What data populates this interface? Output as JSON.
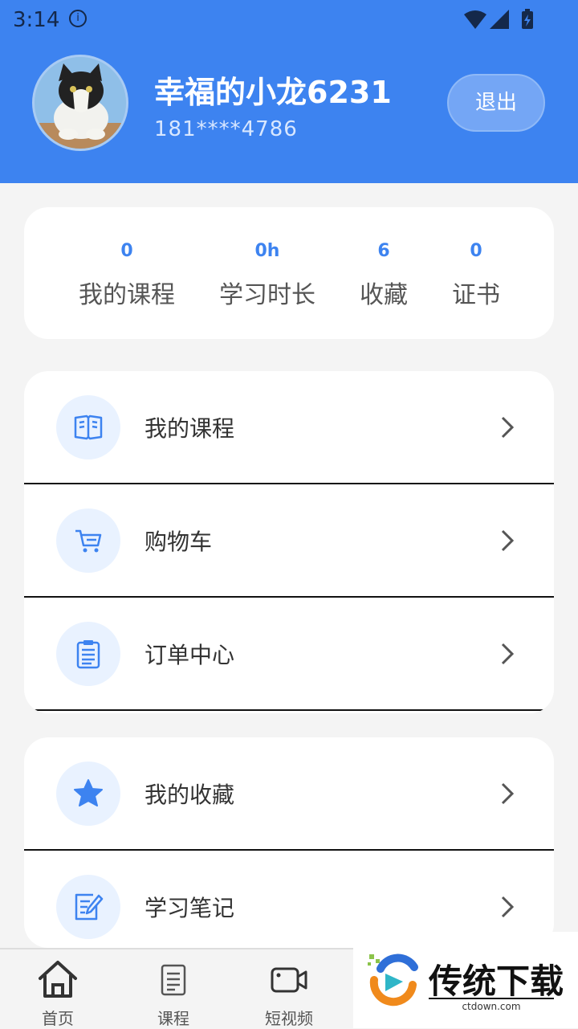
{
  "status_bar": {
    "time": "3:14",
    "info_glyph": "i"
  },
  "profile": {
    "username": "幸福的小龙6231",
    "phone": "181****4786",
    "logout_label": "退出"
  },
  "stats": [
    {
      "value": "0",
      "label": "我的课程"
    },
    {
      "value": "0h",
      "label": "学习时长"
    },
    {
      "value": "6",
      "label": "收藏"
    },
    {
      "value": "0",
      "label": "证书"
    }
  ],
  "menu_group_1": [
    {
      "label": "我的课程",
      "icon": "book-icon"
    },
    {
      "label": "购物车",
      "icon": "cart-icon"
    },
    {
      "label": "订单中心",
      "icon": "clipboard-icon"
    }
  ],
  "menu_group_2": [
    {
      "label": "我的收藏",
      "icon": "star-icon"
    },
    {
      "label": "学习笔记",
      "icon": "note-edit-icon"
    }
  ],
  "tabbar": [
    {
      "label": "首页",
      "icon": "home-icon"
    },
    {
      "label": "课程",
      "icon": "course-list-icon"
    },
    {
      "label": "短视频",
      "icon": "video-camera-icon"
    }
  ],
  "watermark": {
    "title": "传统下载",
    "url": "ctdown.com"
  },
  "colors": {
    "primary": "#3d83f0",
    "background": "#f4f4f4"
  }
}
